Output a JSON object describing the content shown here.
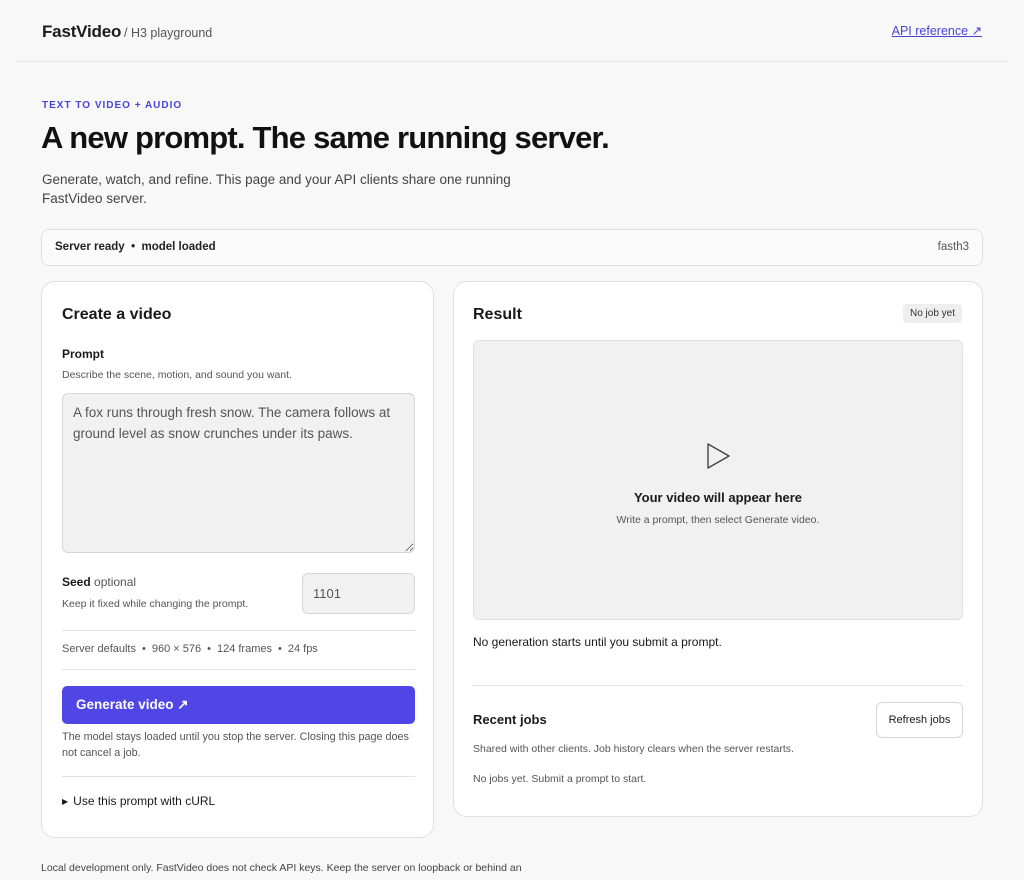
{
  "header": {
    "brand": "FastVideo",
    "crumb": "/ H3 playground",
    "api_link": "API reference ↗"
  },
  "hero": {
    "eyebrow": "TEXT TO VIDEO + AUDIO",
    "title": "A new prompt. The same running server.",
    "lede": "Generate, watch, and refine. This page and your API clients share one running FastVideo server."
  },
  "status": {
    "left": "Server ready  •  model loaded",
    "right": "fasth3"
  },
  "create": {
    "title": "Create a video",
    "prompt_label": "Prompt",
    "prompt_hint": "Describe the scene, motion, and sound you want.",
    "prompt_value": "A fox runs through fresh snow. The camera follows at ground level as snow crunches under its paws.",
    "seed_label": "Seed",
    "seed_optional": "optional",
    "seed_hint": "Keep it fixed while changing the prompt.",
    "seed_value": "1101",
    "defaults": {
      "label": "Server defaults",
      "resolution": "960 × 576",
      "frames": "124 frames",
      "fps": "24 fps"
    },
    "generate_label": "Generate video ↗",
    "note": "The model stays loaded until you stop the server. Closing this page does not cancel a job.",
    "curl_label": "Use this prompt with cURL"
  },
  "result": {
    "title": "Result",
    "badge": "No job yet",
    "preview_title": "Your video will appear here",
    "preview_sub": "Write a prompt, then select Generate video.",
    "no_generation": "No generation starts until you submit a prompt.",
    "recent_title": "Recent jobs",
    "refresh_label": "Refresh jobs",
    "recent_hint": "Shared with other clients. Job history clears when the server restarts.",
    "empty": "No jobs yet. Submit a prompt to start."
  },
  "footer": "Local development only. FastVideo does not check API keys. Keep the server on loopback or behind an"
}
